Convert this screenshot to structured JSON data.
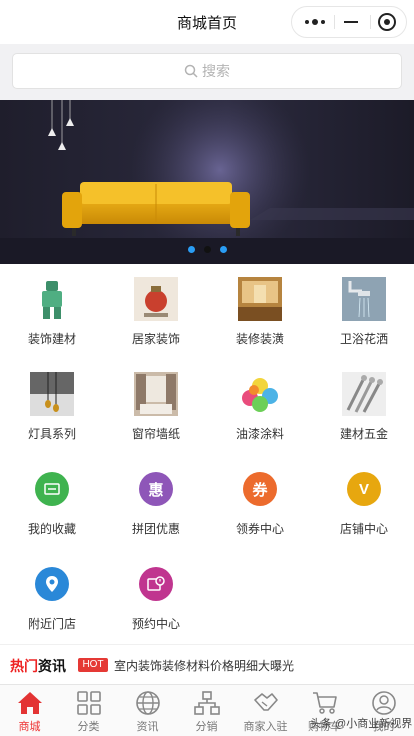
{
  "header": {
    "title": "商城首页"
  },
  "search": {
    "placeholder": "搜索"
  },
  "banner": {
    "slide_count": 3,
    "active_index": 1
  },
  "categories": [
    {
      "label": "装饰建材",
      "icon": "decor-materials-icon"
    },
    {
      "label": "居家装饰",
      "icon": "home-decor-icon"
    },
    {
      "label": "装修装潢",
      "icon": "renovation-icon"
    },
    {
      "label": "卫浴花洒",
      "icon": "shower-icon"
    },
    {
      "label": "灯具系列",
      "icon": "lamp-icon"
    },
    {
      "label": "窗帘墙纸",
      "icon": "curtain-icon"
    },
    {
      "label": "油漆涂料",
      "icon": "paint-icon"
    },
    {
      "label": "建材五金",
      "icon": "hardware-icon"
    },
    {
      "label": "我的收藏",
      "icon": "favorites-icon",
      "color": "#3fb34f"
    },
    {
      "label": "拼团优惠",
      "icon": "group-deal-icon",
      "color": "#8e56b8",
      "glyph": "惠"
    },
    {
      "label": "领券中心",
      "icon": "coupon-icon",
      "color": "#ec6b2d",
      "glyph": "券"
    },
    {
      "label": "店铺中心",
      "icon": "store-icon",
      "color": "#e7a70f",
      "glyph": "V"
    },
    {
      "label": "附近门店",
      "icon": "nearby-store-icon",
      "color": "#2a88d8"
    },
    {
      "label": "预约中心",
      "icon": "booking-icon",
      "color": "#c0358f"
    }
  ],
  "news": {
    "tag_red": "热门",
    "tag_black": "资讯",
    "hot_badge": "HOT",
    "headline": "室内装饰装修材料价格明细大曝光"
  },
  "tabbar": {
    "active_index": 0,
    "accent": "#e33333",
    "items": [
      {
        "label": "商城",
        "icon": "home-icon"
      },
      {
        "label": "分类",
        "icon": "category-grid-icon"
      },
      {
        "label": "资讯",
        "icon": "globe-icon"
      },
      {
        "label": "分销",
        "icon": "network-icon"
      },
      {
        "label": "商家入驻",
        "icon": "handshake-icon"
      },
      {
        "label": "购物车",
        "icon": "cart-icon"
      },
      {
        "label": "我的",
        "icon": "user-icon"
      }
    ]
  },
  "watermark": "头条 @小商业新视界"
}
